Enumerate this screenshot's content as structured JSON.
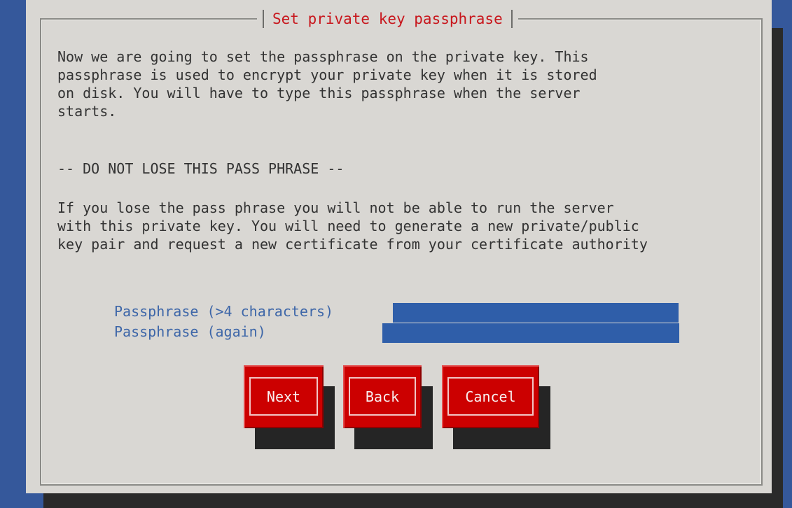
{
  "dialog": {
    "title": "Set private key passphrase",
    "paragraph_1": [
      "Now we are going to set the passphrase on the private key. This",
      "passphrase is used to encrypt your private key when it is stored",
      "on disk. You will have to type this passphrase when the server",
      "starts."
    ],
    "warning": "-- DO NOT LOSE THIS PASS PHRASE --",
    "paragraph_2": [
      "If you lose the pass phrase you will not be able to run the server",
      "with this private key. You will need to generate a new private/public",
      "key pair and request a new certificate from your certificate authority"
    ]
  },
  "form": {
    "passphrase_label": "Passphrase (>4 characters)",
    "passphrase_value": "",
    "passphrase_again_label": "Passphrase (again)",
    "passphrase_again_value": ""
  },
  "buttons": {
    "next": "Next",
    "back": "Back",
    "cancel": "Cancel"
  },
  "colors": {
    "background": "#35589b",
    "dialog": "#d9d7d3",
    "title": "#c8161c",
    "field": "#2f5ea9",
    "button": "#cc0000"
  }
}
